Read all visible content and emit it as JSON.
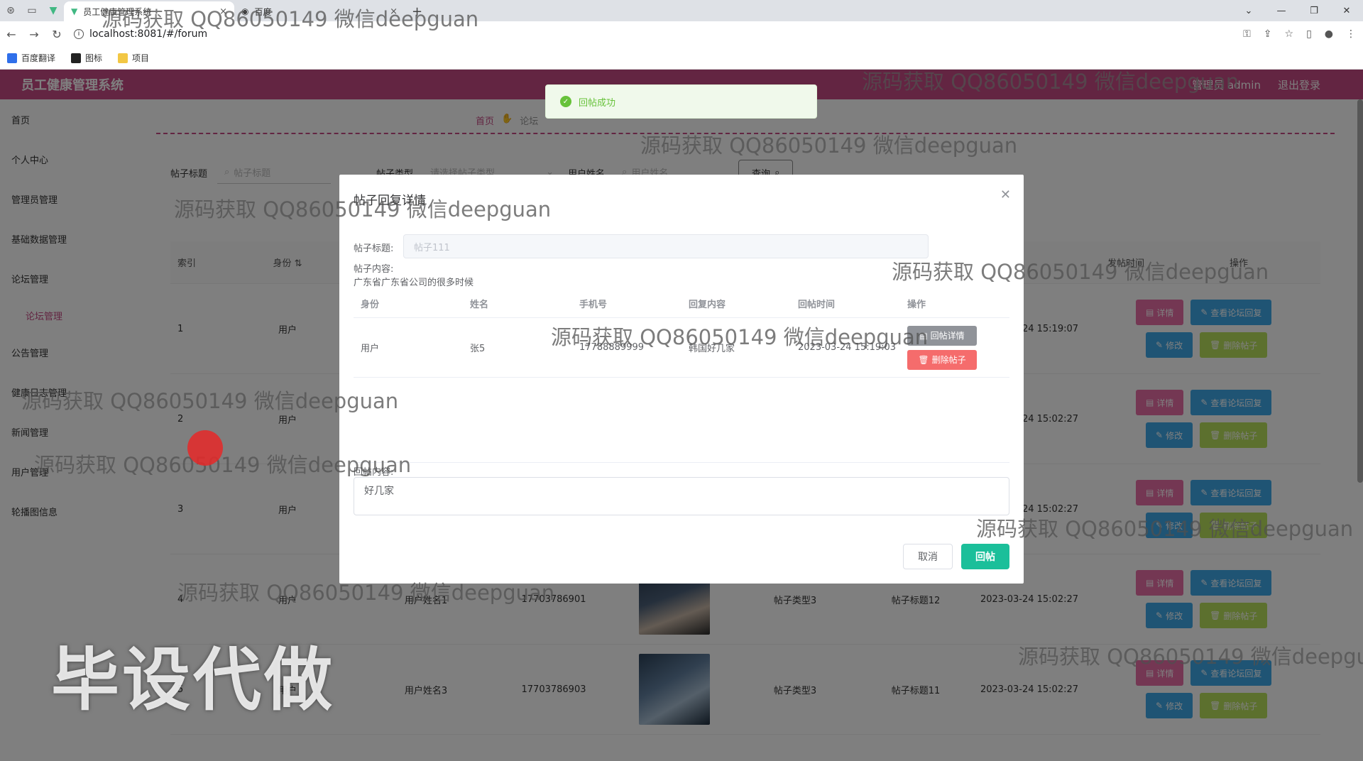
{
  "browser": {
    "tabs": [
      {
        "label": "员工健康管理系统",
        "close": "×"
      },
      {
        "label": "百度",
        "close": "×"
      }
    ],
    "new_tab": "+",
    "url": "localhost:8081/#/forum",
    "bookmarks": [
      {
        "label": "百度翻译",
        "color": "#2f6fea"
      },
      {
        "label": "图标",
        "color": "#222222"
      },
      {
        "label": "项目",
        "color": "#f2c744"
      }
    ]
  },
  "app": {
    "title": "员工健康管理系统",
    "user": "管理员 admin",
    "logout": "退出登录",
    "brand_color": "#c64b84"
  },
  "sidebar": {
    "items": [
      {
        "label": "首页"
      },
      {
        "label": "个人中心"
      },
      {
        "label": "管理员管理"
      },
      {
        "label": "基础数据管理"
      },
      {
        "label": "论坛管理"
      },
      {
        "label": "论坛管理",
        "sub": true
      },
      {
        "label": "公告管理"
      },
      {
        "label": "健康日志管理"
      },
      {
        "label": "新闻管理"
      },
      {
        "label": "用户管理"
      },
      {
        "label": "轮播图信息"
      }
    ]
  },
  "breadcrumb": {
    "home": "首页",
    "current": "论坛"
  },
  "search": {
    "title_label": "帖子标题",
    "title_placeholder": "帖子标题",
    "type_label": "帖子类型",
    "type_placeholder": "请选择帖子类型",
    "user_label": "用户姓名",
    "user_placeholder": "用户姓名",
    "query_btn": "查询"
  },
  "table": {
    "headers": {
      "index": "索引",
      "role": "身份",
      "time": "发帖时间",
      "ops": "操作"
    },
    "rows": [
      {
        "index": "1",
        "role": "用户",
        "name": "",
        "phone": "",
        "type": "",
        "title": "",
        "time": "2023-03-24 15:19:07",
        "avatar": false
      },
      {
        "index": "2",
        "role": "用户",
        "name": "",
        "phone": "",
        "type": "",
        "title": "",
        "time": "2023-03-24 15:02:27",
        "avatar": false
      },
      {
        "index": "3",
        "role": "用户",
        "name": "",
        "phone": "",
        "type": "",
        "title": "",
        "time": "2023-03-24 15:02:27",
        "avatar": false
      },
      {
        "index": "4",
        "role": "用户",
        "name": "用户姓名1",
        "phone": "17703786901",
        "type": "帖子类型3",
        "title": "帖子标题12",
        "time": "2023-03-24 15:02:27",
        "avatar": true
      },
      {
        "index": "5",
        "role": "用户",
        "name": "用户姓名3",
        "phone": "17703786903",
        "type": "帖子类型3",
        "title": "帖子标题11",
        "time": "2023-03-24 15:02:27",
        "avatar": true
      }
    ],
    "op_labels": {
      "detail": "详情",
      "view_reply": "查看论坛回复",
      "edit": "修改",
      "delete": "删除帖子"
    }
  },
  "toast": {
    "message": "回帖成功"
  },
  "dialog": {
    "title": "帖子回复详情",
    "post_title_label": "帖子标题:",
    "post_title_value": "帖子111",
    "post_content_label": "帖子内容:",
    "post_content_value": "广东省广东省公司的很多时候",
    "headers": [
      "身份",
      "姓名",
      "手机号",
      "回复内容",
      "回帖时间",
      "操作"
    ],
    "reply": {
      "role": "用户",
      "name": "张5",
      "phone": "17788889999",
      "content": "韩国好几家",
      "time": "2023-03-24 15:19:03",
      "detail_btn": "回帖详情",
      "delete_btn": "删除帖子"
    },
    "reply_label": "回帖内容:",
    "reply_value": "好几家",
    "cancel": "取消",
    "submit": "回帖"
  },
  "watermarks": {
    "text": "源码获取 QQ86050149 微信deepguan",
    "big": "毕设代做"
  }
}
